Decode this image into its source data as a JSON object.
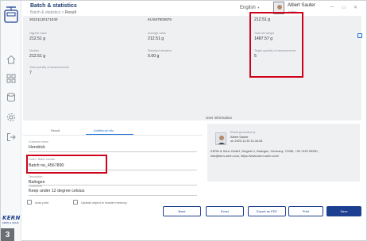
{
  "header": {
    "title": "Batch & statistics",
    "breadcrumb_root": "Batch & statistics",
    "breadcrumb_sep": ">",
    "breadcrumb_current": "Result",
    "language": "English",
    "user_name": "Albert Sauter",
    "user_role": "Admin",
    "minimize": "—",
    "maximize": "▭",
    "close": "✕"
  },
  "summary": {
    "top_row": [
      "20221130171040",
      "KUS67903876",
      "212.51 g"
    ],
    "fields": [
      {
        "label": "Highest value",
        "value": "212.51 g"
      },
      {
        "label": "Average value",
        "value": "212.51 g"
      },
      {
        "label": "Total net weight",
        "value": "1487.57 g"
      },
      {
        "label": "Median",
        "value": "212.51 g"
      },
      {
        "label": "Standard deviation",
        "value": "0.00 g"
      },
      {
        "label": "Target quantity of measurements",
        "value": "5"
      },
      {
        "label": "Total quantity of measurements",
        "value": "7"
      }
    ]
  },
  "tabs": [
    "Result",
    "Additional info"
  ],
  "form": {
    "customer_label": "Customer name",
    "customer_value": "Hendrick",
    "order_label": "Order / Batch number",
    "order_value": "Batch no_4567890",
    "location_label": "Description",
    "location_value": "Balingen",
    "comments_label": "Comments",
    "comments_value": "Keep under 12 degree celsius"
  },
  "user_info": {
    "heading": "User information",
    "generated_by": "Result generated by",
    "name": "Albert Sauter",
    "date": "on 2022.11.30 11:44:54",
    "address": "KERN & Sohn GmbH, Ziegelei 1, Balingen, Germany, 72336, +49 7433 99330,",
    "contact": "info@kern-sohn.com, https://www.kern-sohn.com/"
  },
  "footer": {
    "auto_print": "Auto print",
    "update_label": "Update object in master memory",
    "back": "Back",
    "excel": "Excel",
    "export_pdf": "Export as PDF",
    "print": "Print",
    "save": "Save"
  },
  "logo": {
    "brand": "KERN",
    "sub": "KERN & SOHN"
  },
  "step_badge": "3",
  "colors": {
    "accent": "#1d3f8f",
    "highlight": "#d0021b",
    "panel": "#eef0f2"
  }
}
